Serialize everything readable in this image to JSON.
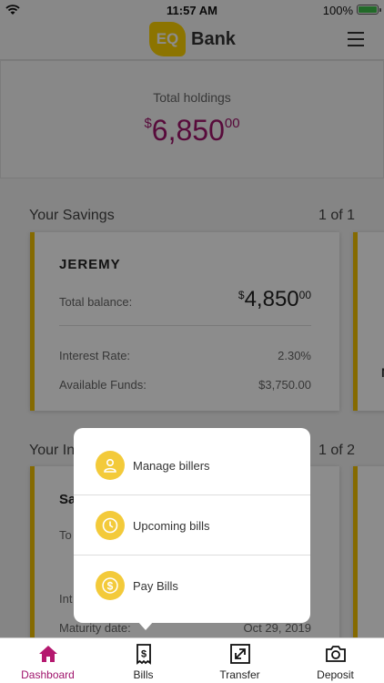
{
  "status_bar": {
    "time": "11:57 AM",
    "battery": "100%"
  },
  "header": {
    "logo_mark": "EQ",
    "logo_text": "Bank",
    "menu_icon": "hamburger-menu-icon"
  },
  "holdings": {
    "label": "Total holdings",
    "currency_symbol": "$",
    "amount": "6,850",
    "cents": "00"
  },
  "savings": {
    "title": "Your Savings",
    "pager": "1 of 1",
    "card": {
      "name": "JEREMY",
      "balance_label": "Total balance:",
      "balance_symbol": "$",
      "balance_amount": "4,850",
      "balance_cents": "00",
      "interest_label": "Interest Rate:",
      "interest_value": "2.30%",
      "available_label": "Available Funds:",
      "available_value": "$3,750.00"
    }
  },
  "investments": {
    "title_partial": "Your In",
    "pager": "1 of 2",
    "card": {
      "name_partial": "Sa",
      "balance_label_partial": "To",
      "rate_label_partial": "Int",
      "maturity_label": "Maturity date:",
      "maturity_value": "Oct 29, 2019"
    }
  },
  "bills_menu": {
    "items": [
      {
        "label": "Manage billers",
        "icon": "person-icon"
      },
      {
        "label": "Upcoming bills",
        "icon": "clock-icon"
      },
      {
        "label": "Pay Bills",
        "icon": "dollar-icon"
      }
    ]
  },
  "tab_bar": {
    "tabs": [
      {
        "label": "Dashboard",
        "icon": "home-icon",
        "active": true
      },
      {
        "label": "Bills",
        "icon": "receipt-icon",
        "active": false
      },
      {
        "label": "Transfer",
        "icon": "transfer-icon",
        "active": false
      },
      {
        "label": "Deposit",
        "icon": "camera-icon",
        "active": false
      }
    ]
  },
  "colors": {
    "brand_yellow": "#ffd400",
    "accent_magenta": "#a0146c",
    "icon_yellow": "#f3ca3a"
  }
}
